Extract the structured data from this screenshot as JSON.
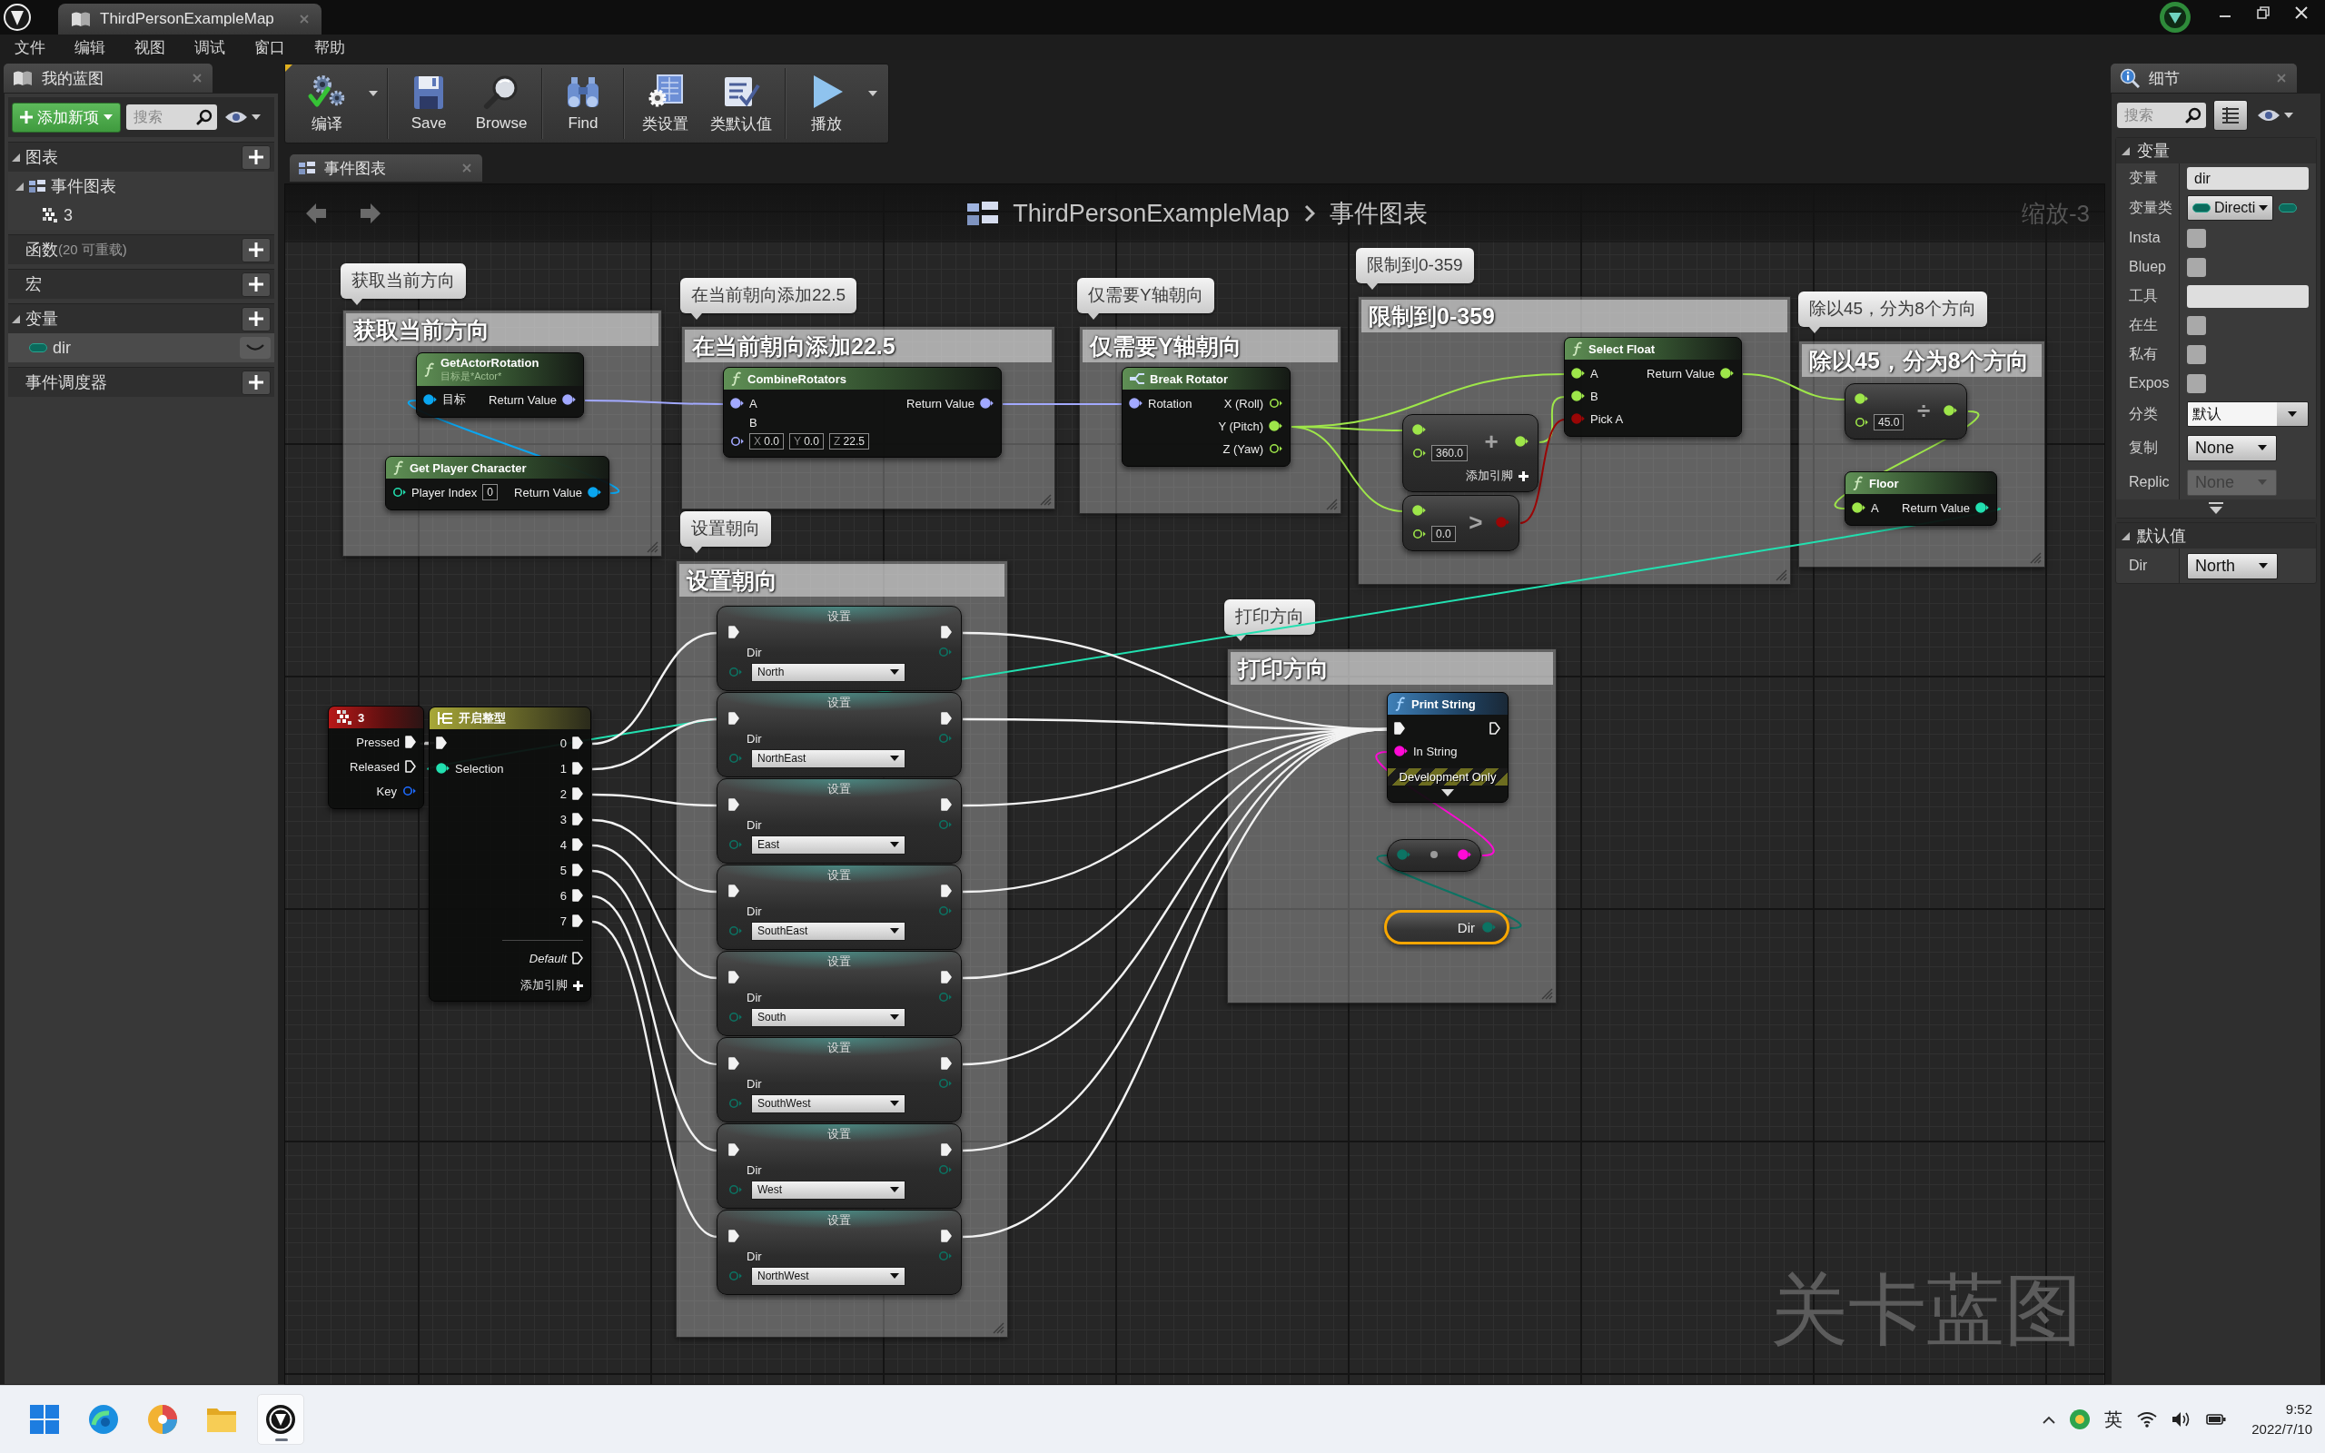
{
  "title_bar": {
    "tab": "ThirdPersonExampleMap"
  },
  "menu": [
    "文件",
    "编辑",
    "视图",
    "调试",
    "窗口",
    "帮助"
  ],
  "my_blueprint": {
    "tab": "我的蓝图",
    "add_button": "添加新项",
    "search": {
      "placeholder": "搜索"
    },
    "sections": [
      {
        "label": "图表",
        "items": [
          {
            "label": "事件图表",
            "kind": "graph",
            "selected": false,
            "children": [
              {
                "label": "3",
                "kind": "event",
                "selected": false
              }
            ]
          }
        ]
      },
      {
        "label": "函数",
        "note": "(20 可重载)"
      },
      {
        "label": "宏"
      },
      {
        "label": "变量",
        "items": [
          {
            "label": "dir",
            "kind": "variable",
            "selected": true
          }
        ]
      },
      {
        "label": "事件调度器"
      }
    ]
  },
  "toolbar": {
    "groups": [
      {
        "buttons": [
          {
            "label": "编译",
            "kind": "compile",
            "dropdown": true
          }
        ]
      },
      {
        "buttons": [
          {
            "label": "Save",
            "kind": "save",
            "dropdown": false
          },
          {
            "label": "Browse",
            "kind": "browse",
            "dropdown": false
          }
        ]
      },
      {
        "buttons": [
          {
            "label": "Find",
            "kind": "find",
            "dropdown": false
          }
        ]
      },
      {
        "buttons": [
          {
            "label": "类设置",
            "kind": "class_settings",
            "dropdown": false
          },
          {
            "label": "类默认值",
            "kind": "class_defaults",
            "dropdown": false
          }
        ]
      },
      {
        "buttons": [
          {
            "label": "播放",
            "kind": "play",
            "dropdown": true
          }
        ]
      }
    ]
  },
  "graph": {
    "tab": "事件图表",
    "breadcrumb": [
      "ThirdPersonExampleMap",
      "事件图表"
    ],
    "zoom": "缩放-3",
    "graph_type": "关卡蓝图",
    "comments": [
      {
        "bubble": "获取当前方向",
        "title": "获取当前方向",
        "nodes": [
          {
            "kind": "function",
            "title": "GetActorRotation",
            "subtitle": "目标是*Actor*",
            "selected": false,
            "inputs": [
              {
                "label": "目标",
                "kind": "object",
                "connected": true
              }
            ],
            "outputs": [
              {
                "label": "Return Value",
                "kind": "rotator",
                "connected": true
              }
            ]
          },
          {
            "kind": "function",
            "title": "Get Player Character",
            "selected": false,
            "inputs": [
              {
                "label": "Player Index",
                "kind": "int",
                "connected": false,
                "value": "0"
              }
            ],
            "outputs": [
              {
                "label": "Return Value",
                "kind": "object",
                "connected": true
              }
            ]
          }
        ]
      },
      {
        "bubble": "在当前朝向添加22.5",
        "title": "在当前朝向添加22.5",
        "nodes": [
          {
            "kind": "function",
            "title": "CombineRotators",
            "selected": false,
            "inputs": [
              {
                "label": "A",
                "kind": "rotator",
                "connected": true
              },
              {
                "label": "B",
                "kind": "rotator",
                "connected": false,
                "fields": [
                  {
                    "axis": "X",
                    "value": "0.0"
                  },
                  {
                    "axis": "Y",
                    "value": "0.0"
                  },
                  {
                    "axis": "Z",
                    "value": "22.5"
                  }
                ]
              }
            ],
            "outputs": [
              {
                "label": "Return Value",
                "kind": "rotator",
                "connected": true
              }
            ]
          }
        ]
      },
      {
        "bubble": "仅需要Y轴朝向",
        "title": "仅需要Y轴朝向",
        "nodes": [
          {
            "kind": "break",
            "title": "Break Rotator",
            "selected": false,
            "inputs": [
              {
                "label": "Rotation",
                "kind": "rotator",
                "connected": true
              }
            ],
            "outputs": [
              {
                "label": "X (Roll)",
                "kind": "float",
                "connected": false
              },
              {
                "label": "Y (Pitch)",
                "kind": "float",
                "connected": true
              },
              {
                "label": "Z (Yaw)",
                "kind": "float",
                "connected": false
              }
            ]
          }
        ]
      },
      {
        "bubble": "限制到0-359",
        "title": "限制到0-359",
        "nodes": [
          {
            "kind": "operator",
            "symbol": "+",
            "add_pin": "添加引脚",
            "selected": false,
            "inputs": [
              {
                "kind": "float",
                "connected": true
              },
              {
                "kind": "float",
                "connected": false,
                "value": "360.0"
              }
            ],
            "outputs": [
              {
                "kind": "float",
                "connected": true
              }
            ]
          },
          {
            "kind": "operator",
            "symbol": ">",
            "selected": false,
            "inputs": [
              {
                "kind": "float",
                "connected": true
              },
              {
                "kind": "float",
                "connected": false,
                "value": "0.0"
              }
            ],
            "outputs": [
              {
                "kind": "bool",
                "connected": true
              }
            ]
          },
          {
            "kind": "function",
            "title": "Select Float",
            "selected": false,
            "inputs": [
              {
                "label": "A",
                "kind": "float",
                "connected": true
              },
              {
                "label": "B",
                "kind": "float",
                "connected": true
              },
              {
                "label": "Pick A",
                "kind": "bool",
                "connected": true
              }
            ],
            "outputs": [
              {
                "label": "Return Value",
                "kind": "float",
                "connected": true
              }
            ]
          }
        ]
      },
      {
        "bubble": "除以45，分为8个方向",
        "title": "除以45，分为8个方向",
        "nodes": [
          {
            "kind": "operator",
            "symbol": "÷",
            "selected": false,
            "inputs": [
              {
                "kind": "float",
                "connected": true
              },
              {
                "kind": "float",
                "connected": false,
                "value": "45.0"
              }
            ],
            "outputs": [
              {
                "kind": "float",
                "connected": true
              }
            ]
          },
          {
            "kind": "function",
            "title": "Floor",
            "selected": false,
            "inputs": [
              {
                "label": "A",
                "kind": "float",
                "connected": true
              }
            ],
            "outputs": [
              {
                "label": "Return Value",
                "kind": "int",
                "connected": true
              }
            ]
          }
        ]
      },
      {
        "bubble": "设置朝向",
        "title": "设置朝向",
        "nodes": [
          {
            "kind": "set",
            "title": "设置",
            "selected": false,
            "inputs": [
              {
                "kind": "exec",
                "connected": true
              },
              {
                "label": "Dir",
                "kind": "enum",
                "connected": false,
                "value": "North"
              }
            ],
            "outputs": [
              {
                "kind": "exec",
                "connected": true
              },
              {
                "kind": "enum",
                "connected": false
              }
            ]
          },
          {
            "kind": "set",
            "title": "设置",
            "selected": false,
            "inputs": [
              {
                "kind": "exec",
                "connected": true
              },
              {
                "label": "Dir",
                "kind": "enum",
                "connected": false,
                "value": "NorthEast"
              }
            ],
            "outputs": [
              {
                "kind": "exec",
                "connected": true
              },
              {
                "kind": "enum",
                "connected": false
              }
            ]
          },
          {
            "kind": "set",
            "title": "设置",
            "selected": false,
            "inputs": [
              {
                "kind": "exec",
                "connected": true
              },
              {
                "label": "Dir",
                "kind": "enum",
                "connected": false,
                "value": "East"
              }
            ],
            "outputs": [
              {
                "kind": "exec",
                "connected": true
              },
              {
                "kind": "enum",
                "connected": false
              }
            ]
          },
          {
            "kind": "set",
            "title": "设置",
            "selected": false,
            "inputs": [
              {
                "kind": "exec",
                "connected": true
              },
              {
                "label": "Dir",
                "kind": "enum",
                "connected": false,
                "value": "SouthEast"
              }
            ],
            "outputs": [
              {
                "kind": "exec",
                "connected": true
              },
              {
                "kind": "enum",
                "connected": false
              }
            ]
          },
          {
            "kind": "set",
            "title": "设置",
            "selected": false,
            "inputs": [
              {
                "kind": "exec",
                "connected": true
              },
              {
                "label": "Dir",
                "kind": "enum",
                "connected": false,
                "value": "South"
              }
            ],
            "outputs": [
              {
                "kind": "exec",
                "connected": true
              },
              {
                "kind": "enum",
                "connected": false
              }
            ]
          },
          {
            "kind": "set",
            "title": "设置",
            "selected": false,
            "inputs": [
              {
                "kind": "exec",
                "connected": true
              },
              {
                "label": "Dir",
                "kind": "enum",
                "connected": false,
                "value": "SouthWest"
              }
            ],
            "outputs": [
              {
                "kind": "exec",
                "connected": true
              },
              {
                "kind": "enum",
                "connected": false
              }
            ]
          },
          {
            "kind": "set",
            "title": "设置",
            "selected": false,
            "inputs": [
              {
                "kind": "exec",
                "connected": true
              },
              {
                "label": "Dir",
                "kind": "enum",
                "connected": false,
                "value": "West"
              }
            ],
            "outputs": [
              {
                "kind": "exec",
                "connected": true
              },
              {
                "kind": "enum",
                "connected": false
              }
            ]
          },
          {
            "kind": "set",
            "title": "设置",
            "selected": false,
            "inputs": [
              {
                "kind": "exec",
                "connected": true
              },
              {
                "label": "Dir",
                "kind": "enum",
                "connected": false,
                "value": "NorthWest"
              }
            ],
            "outputs": [
              {
                "kind": "exec",
                "connected": true
              },
              {
                "kind": "enum",
                "connected": false
              }
            ]
          }
        ]
      },
      {
        "bubble": "打印方向",
        "title": "打印方向",
        "nodes": [
          {
            "kind": "call",
            "title": "Print String",
            "selected": false,
            "inputs": [
              {
                "kind": "exec",
                "connected": true
              },
              {
                "label": "In String",
                "kind": "string",
                "connected": true
              }
            ],
            "outputs": [
              {
                "kind": "exec",
                "connected": false
              }
            ],
            "banner": "Development Only"
          },
          {
            "kind": "convert",
            "selected": false,
            "inputs": [
              {
                "kind": "enum",
                "connected": true
              }
            ],
            "outputs": [
              {
                "kind": "string",
                "connected": true
              }
            ]
          },
          {
            "kind": "getter",
            "label": "Dir",
            "selected": true,
            "outputs": [
              {
                "kind": "enum",
                "connected": true
              }
            ]
          }
        ]
      }
    ],
    "nodes": [
      {
        "kind": "input_key",
        "title": "3",
        "selected": false,
        "outputs": [
          {
            "label": "Pressed",
            "kind": "exec",
            "connected": true
          },
          {
            "label": "Released",
            "kind": "exec",
            "connected": false
          },
          {
            "label": "Key",
            "kind": "struct",
            "connected": false
          }
        ]
      },
      {
        "kind": "switch",
        "title": "开启整型",
        "selected": false,
        "inputs": [
          {
            "kind": "exec",
            "connected": true
          },
          {
            "label": "Selection",
            "kind": "int",
            "connected": true
          }
        ],
        "outputs": [
          {
            "label": "0",
            "kind": "exec",
            "connected": true
          },
          {
            "label": "1",
            "kind": "exec",
            "connected": true
          },
          {
            "label": "2",
            "kind": "exec",
            "connected": true
          },
          {
            "label": "3",
            "kind": "exec",
            "connected": true
          },
          {
            "label": "4",
            "kind": "exec",
            "connected": true
          },
          {
            "label": "5",
            "kind": "exec",
            "connected": true
          },
          {
            "label": "6",
            "kind": "exec",
            "connected": true
          },
          {
            "label": "7",
            "kind": "exec",
            "connected": true
          }
        ],
        "default_pin": {
          "label": "Default",
          "kind": "exec",
          "connected": false
        },
        "add_pin": "添加引脚"
      }
    ]
  },
  "details": {
    "tab": "细节",
    "search": {
      "placeholder": "搜索"
    },
    "sections": [
      {
        "label": "变量",
        "advanced": true,
        "rows": [
          {
            "label": "变量",
            "kind": "text",
            "value": "dir"
          },
          {
            "label": "变量类",
            "kind": "type",
            "value": "Directi"
          },
          {
            "label": "Insta",
            "kind": "checkbox",
            "checked": false
          },
          {
            "label": "Bluep",
            "kind": "checkbox",
            "checked": false
          },
          {
            "label": "工具",
            "kind": "text"
          },
          {
            "label": "在生",
            "kind": "checkbox",
            "checked": false
          },
          {
            "label": "私有",
            "kind": "checkbox",
            "checked": false
          },
          {
            "label": "Expos",
            "kind": "checkbox",
            "checked": false
          },
          {
            "label": "分类",
            "kind": "combo",
            "value": "默认"
          },
          {
            "label": "复制",
            "kind": "dropdown",
            "value": "None",
            "disabled": false
          },
          {
            "label": "Replic",
            "kind": "dropdown",
            "value": "None",
            "disabled": true
          }
        ]
      },
      {
        "label": "默认值",
        "advanced": false,
        "rows": [
          {
            "label": "Dir",
            "kind": "dropdown",
            "value": "North",
            "disabled": false
          }
        ]
      }
    ]
  },
  "taskbar": {
    "apps": [
      {
        "kind": "start",
        "selected": false
      },
      {
        "kind": "browser",
        "selected": false
      },
      {
        "kind": "app",
        "selected": false
      },
      {
        "kind": "folder",
        "selected": false
      },
      {
        "kind": "engine",
        "selected": true
      }
    ],
    "tray": {
      "input_method": "英",
      "time": "9:52",
      "date": "2022/7/10"
    }
  }
}
